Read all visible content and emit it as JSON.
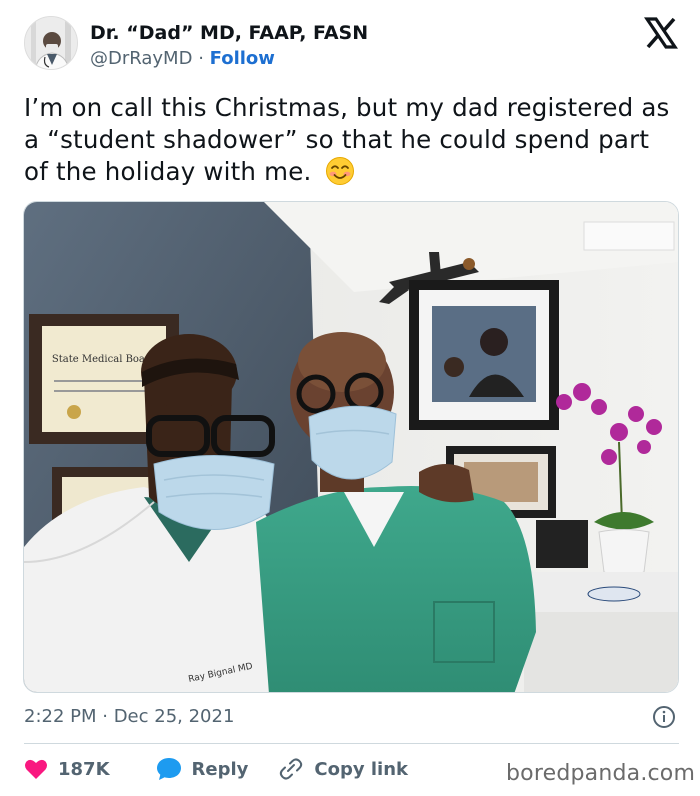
{
  "header": {
    "display_name": "Dr. “Dad” MD, FAAP, FASN",
    "handle": "@DrRayMD",
    "separator": "·",
    "follow_label": "Follow",
    "avatar_icon": "avatar-photo",
    "logo_icon": "x-logo"
  },
  "tweet": {
    "text": "I’m on call this Christmas, but my dad registered as a “student shadower” so that he could spend part of the holiday with me.",
    "emoji_icon": "smiling-face-with-smiling-eyes-emoji",
    "media_icon": "photo-two-men-in-doctors-office",
    "timestamp": "2:22 PM · Dec 25, 2021"
  },
  "actions": {
    "like_count": "187K",
    "reply_label": "Reply",
    "copy_link_label": "Copy link"
  },
  "watermark": "boredpanda.com",
  "colors": {
    "text": "#0f1419",
    "secondary": "#536471",
    "link": "#1d6fd1",
    "like": "#f91880",
    "reply": "#1d9bf0"
  }
}
